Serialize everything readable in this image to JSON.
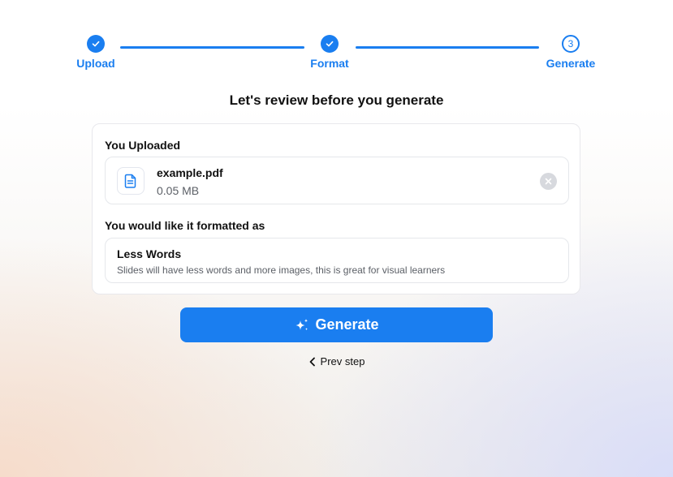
{
  "stepper": {
    "steps": [
      {
        "label": "Upload",
        "status": "completed",
        "icon": "check-icon"
      },
      {
        "label": "Format",
        "status": "completed",
        "icon": "check-icon"
      },
      {
        "label": "Generate",
        "status": "current",
        "number": "3"
      }
    ]
  },
  "review": {
    "title": "Let's review before you generate",
    "uploaded_heading": "You Uploaded",
    "file": {
      "name": "example.pdf",
      "size": "0.05 MB",
      "icon": "document-icon",
      "remove_icon": "close-icon"
    },
    "format_heading": "You would like it formatted as",
    "format": {
      "title": "Less Words",
      "description": "Slides will have less words and more images, this is great for visual learners"
    }
  },
  "actions": {
    "generate_label": "Generate",
    "generate_icon": "sparkle-icon",
    "prev_label": "Prev step",
    "prev_icon": "chevron-left-icon"
  },
  "colors": {
    "accent": "#1a7ef0",
    "text": "#111111",
    "muted": "#5b5f66"
  }
}
